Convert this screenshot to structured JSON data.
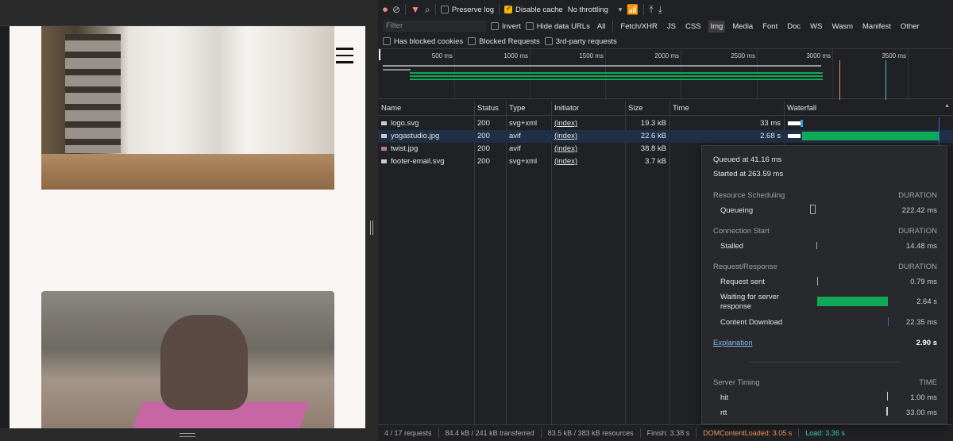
{
  "toolbar": {
    "preserve_log": "Preserve log",
    "disable_cache": "Disable cache",
    "throttling": "No throttling"
  },
  "filter": {
    "placeholder": "Filter",
    "invert": "Invert",
    "hide_data_urls": "Hide data URLs",
    "types": [
      "All",
      "Fetch/XHR",
      "JS",
      "CSS",
      "Img",
      "Media",
      "Font",
      "Doc",
      "WS",
      "Wasm",
      "Manifest",
      "Other"
    ],
    "active_type": "Img",
    "has_blocked_cookies": "Has blocked cookies",
    "blocked_requests": "Blocked Requests",
    "third_party": "3rd-party requests"
  },
  "overview": {
    "ticks": [
      "500 ms",
      "1000 ms",
      "1500 ms",
      "2000 ms",
      "2500 ms",
      "3000 ms",
      "3500 ms"
    ]
  },
  "table": {
    "headers": [
      "Name",
      "Status",
      "Type",
      "Initiator",
      "Size",
      "Time",
      "Waterfall"
    ],
    "rows": [
      {
        "name": "logo.svg",
        "status": "200",
        "type": "svg+xml",
        "initiator": "(index)",
        "size": "19.3 kB",
        "time": "33 ms"
      },
      {
        "name": "yogastudio.jpg",
        "status": "200",
        "type": "avif",
        "initiator": "(index)",
        "size": "22.6 kB",
        "time": "2.68 s"
      },
      {
        "name": "twist.jpg",
        "status": "200",
        "type": "avif",
        "initiator": "(index)",
        "size": "38.8 kB",
        "time": ""
      },
      {
        "name": "footer-email.svg",
        "status": "200",
        "type": "svg+xml",
        "initiator": "(index)",
        "size": "3.7 kB",
        "time": ""
      }
    ]
  },
  "tooltip": {
    "queued": "Queued at 41.16 ms",
    "started": "Started at 263.59 ms",
    "duration": "DURATION",
    "scheduling": "Resource Scheduling",
    "queueing": "Queueing",
    "queueing_v": "222.42 ms",
    "conn": "Connection Start",
    "stalled": "Stalled",
    "stalled_v": "14.48 ms",
    "reqres": "Request/Response",
    "sent": "Request sent",
    "sent_v": "0.79 ms",
    "waiting": "Waiting for server response",
    "waiting_v": "2.64 s",
    "download": "Content Download",
    "download_v": "22.35 ms",
    "explanation": "Explanation",
    "total": "2.90 s",
    "server_timing": "Server Timing",
    "time": "TIME",
    "hit": "hit",
    "hit_v": "1.00 ms",
    "rtt": "rtt",
    "rtt_v": "33.00 ms"
  },
  "status": {
    "requests": "4 / 17 requests",
    "transferred": "84.4 kB / 241 kB transferred",
    "resources": "83.5 kB / 383 kB resources",
    "finish": "Finish: 3.38 s",
    "dcl": "DOMContentLoaded: 3.05 s",
    "load": "Load: 3.36 s"
  },
  "colors": {
    "dcl": "#e8915a",
    "load": "#3cc9a8",
    "bar": "#0fa958",
    "accent": "#8ab4f8"
  }
}
